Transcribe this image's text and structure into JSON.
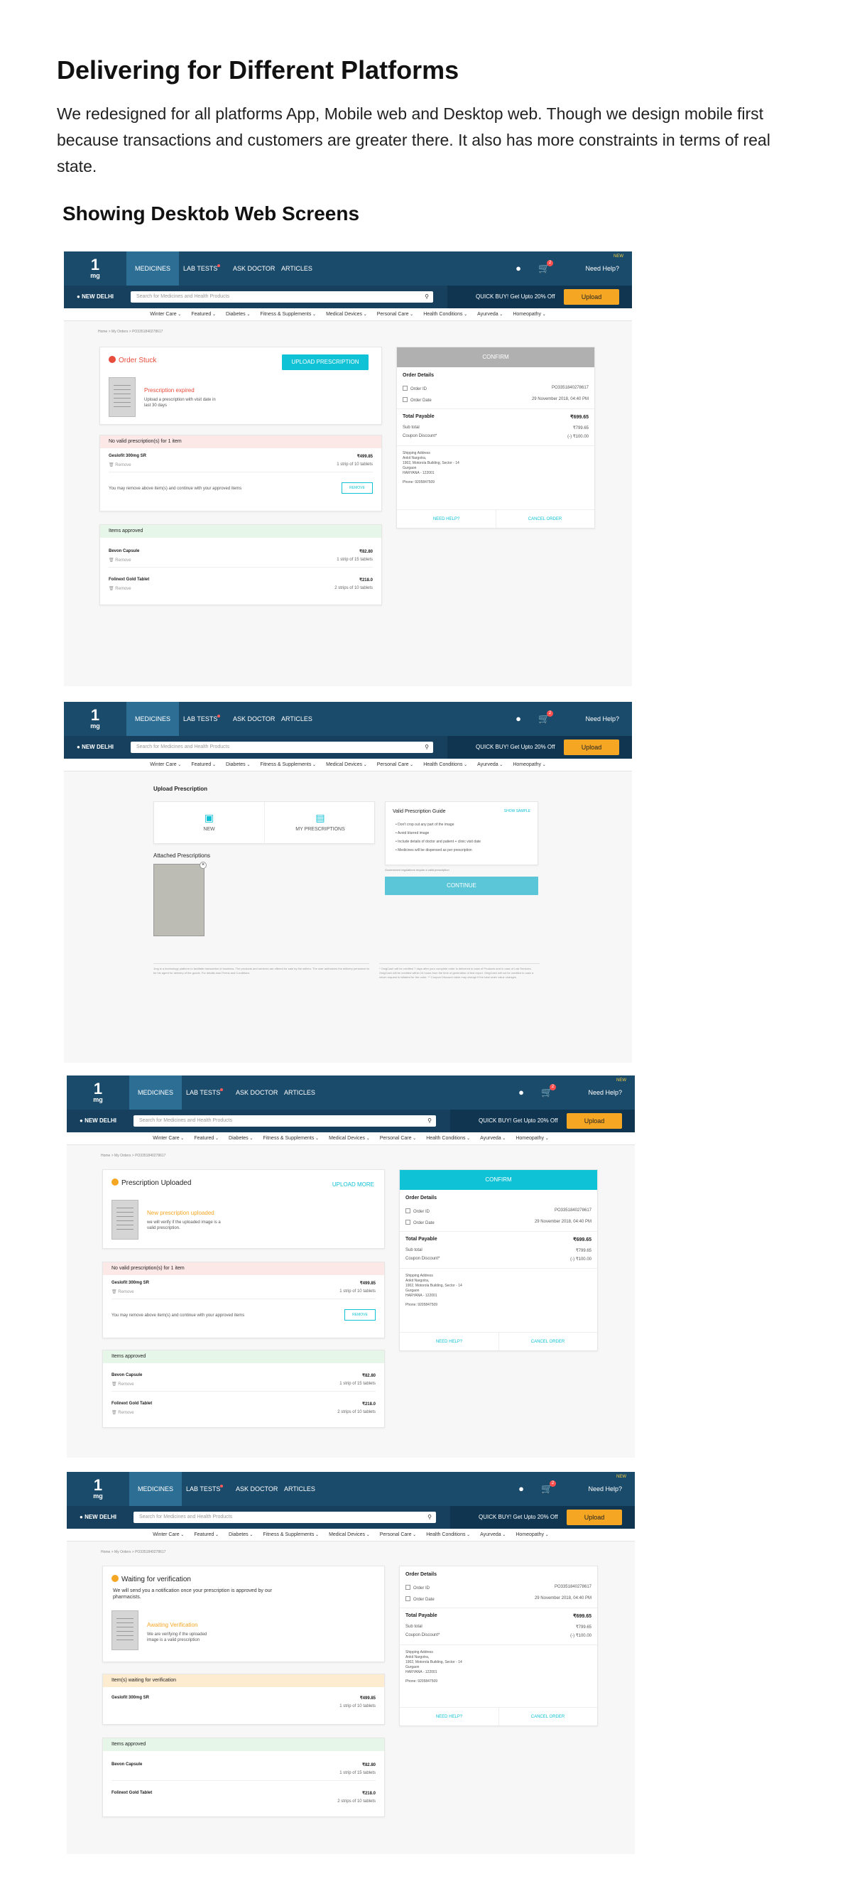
{
  "intro": {
    "title": "Delivering for Different Platforms",
    "body": "We redesigned for all platforms App, Mobile web and Desktop web. Though we design mobile first because transactions and customers are greater there. It also has more constraints in terms of real state.",
    "subtitle": "Showing Desktob Web Screens"
  },
  "header": {
    "logo_one": "1",
    "logo_mg": "mg",
    "tabs": [
      "MEDICINES",
      "LAB TESTS",
      "ASK DOCTOR",
      "ARTICLES"
    ],
    "cart_count": "2",
    "help": "Need Help?",
    "help_badge": "NEW",
    "location": "NEW DELHI",
    "search_placeholder": "Search for Medicines and Health Products",
    "quick_buy": "QUICK BUY! Get Upto 20% Off",
    "upload": "Upload"
  },
  "categories": [
    "Winter Care",
    "Featured",
    "Diabetes",
    "Fitness & Supplements",
    "Medical Devices",
    "Personal Care",
    "Health Conditions",
    "Ayurveda",
    "Homeopathy"
  ],
  "breadcrumb": "Home  >  My Orders  >  PO3351840278617",
  "order_details": {
    "title": "Order Details",
    "order_id_label": "Order ID",
    "order_id": "PO3351840278617",
    "order_date_label": "Order Date",
    "order_date": "29 November 2018, 04:40 PM",
    "total_label": "Total Payable",
    "total": "₹699.65",
    "subtotal_label": "Sub total",
    "subtotal": "₹799.65",
    "coupon_label": "Coupon Discount*",
    "coupon": "(-) ₹100.00",
    "address_label": "Shipping Address",
    "address_name": "Ankit Nargotra,",
    "address_line1": "1902, Motorola Building, Sector - 14",
    "address_line2": "Gurgaon",
    "address_line3": "HARYANA - 122001",
    "phone": "Phone: 9205847509",
    "need_help": "NEED HELP?",
    "cancel": "CANCEL ORDER"
  },
  "items": {
    "invalid_head": "No valid prescription(s) for 1 item",
    "waiting_head": "Item(s) waiting for verification",
    "approved_head": "Items approved",
    "gesloft_name": "Geslofit 300mg SR",
    "gesloft_price": "₹499.85",
    "gesloft_qty": "1 strip of 10 tablets",
    "bevon_name": "Bevon Capsule",
    "bevon_price": "₹82.80",
    "bevon_qty": "1 strip of 15 tablets",
    "folinext_name": "Folinext Gold Tablet",
    "folinext_price": "₹218.0",
    "folinext_qty": "2 strips of 10 tablets",
    "remove": "Remove",
    "remove_note": "You may remove above item(s) and continue with your approved items",
    "remove_btn": "REMOVE"
  },
  "screen1": {
    "status": "Order Stuck",
    "upload_btn": "UPLOAD PRESCRIPTION",
    "expired": "Prescription expired",
    "expired_note": "Upload a prescription with visit date in last 30 days",
    "confirm": "CONFIRM"
  },
  "screen2": {
    "title": "Upload Prescription",
    "new": "NEW",
    "my_prescriptions": "MY PRESCRIPTIONS",
    "attached": "Attached Prescriptions",
    "guide_title": "Valid Prescription Guide",
    "show_sample": "SHOW SAMPLE",
    "guide": [
      "Don't crop out any part of the image",
      "Avoid blurred image",
      "Include details of doctor and patient + clinic visit date",
      "Medicines will be dispensed as per prescription"
    ],
    "gov_note": "Government regulations require a valid prescription",
    "continue": "CONTINUE",
    "footer_left": "1mg is a technology platform to facilitate transaction of business. The products and services are offered for sale by the sellers. The user authorizes the delivery personnel to be his agent for delivery of the goods. For details read Terms and Conditions",
    "footer_right": "* OnigCash will be credited 7 days after your complete order is delivered in case of Products and in case of Lab Services, OnigCash will be credited within 24 hours from the time of generation of test report. OnigCash will not be credited in case a return request is initiated for the order. ** Coupon Discount value may change if the total order value changes"
  },
  "screen3": {
    "status": "Prescription Uploaded",
    "upload_more": "UPLOAD MORE",
    "uploaded": "New prescription uploaded",
    "uploaded_note": "we will verify if the uploaded image is a valid prescription.",
    "confirm": "CONFIRM"
  },
  "screen4": {
    "status": "Waiting for verification",
    "status_note": "We will send you a notification once your prescription is approved by our pharmacists.",
    "awaiting": "Awaiting Verification",
    "awaiting_note": "We are verifying if the uploaded image is a valid prescription"
  },
  "colors": {
    "header": "#1b4b6b",
    "accent": "#10c2d6",
    "upload": "#f5a623",
    "danger": "#e74c3c",
    "warning": "#f5a623"
  }
}
